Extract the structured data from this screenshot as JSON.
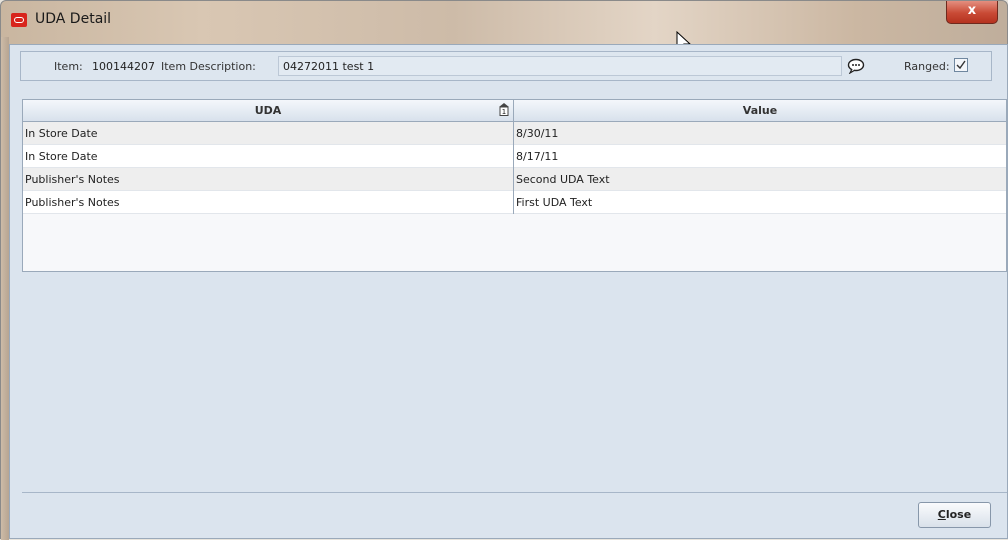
{
  "window": {
    "title": "UDA Detail",
    "close_glyph": "x"
  },
  "info": {
    "item_label": "Item:",
    "item_value": "100144207",
    "desc_label": "Item Description:",
    "desc_value": "04272011 test 1",
    "ranged_label": "Ranged:",
    "ranged_checked": true
  },
  "table": {
    "columns": [
      "UDA",
      "Value"
    ],
    "sort_indicator": "1",
    "rows": [
      {
        "uda": "In Store Date",
        "value": "8/30/11"
      },
      {
        "uda": "In Store Date",
        "value": "8/17/11"
      },
      {
        "uda": "Publisher's Notes",
        "value": "Second UDA Text"
      },
      {
        "uda": "Publisher's Notes",
        "value": "First UDA Text"
      }
    ]
  },
  "footer": {
    "close_label_first": "C",
    "close_label_rest": "lose"
  },
  "icons": {
    "app": "oracle-logo-icon",
    "comment": "speech-bubble-icon",
    "sort": "sort-ascending-icon",
    "cursor": "mouse-pointer-icon"
  },
  "colors": {
    "panel_bg": "#dbe4ee",
    "close_red": "#c94a35",
    "row_alt": "#eeeeee"
  }
}
